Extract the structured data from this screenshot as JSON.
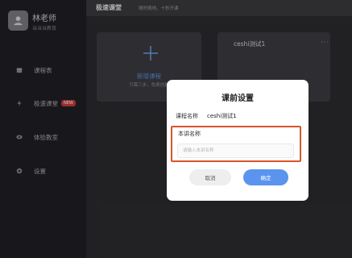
{
  "sidebar": {
    "teacher_name": "林老师",
    "org": "当当当教育",
    "items": [
      {
        "label": "课程表",
        "icon": "calendar-icon"
      },
      {
        "label": "极速课堂",
        "icon": "lightning-icon",
        "badge": "NEW"
      },
      {
        "label": "体验教室",
        "icon": "eye-icon"
      },
      {
        "label": "设置",
        "icon": "gear-icon"
      }
    ]
  },
  "header": {
    "title": "极速课堂",
    "subtitle": "随时随地，十秒开课"
  },
  "cards": {
    "new_title": "新增课程",
    "new_sub": "只需三步，免费创建",
    "course_name": "ceshi测试1",
    "menu_dots": "···"
  },
  "modal": {
    "title": "课前设置",
    "course_label": "课程名称",
    "course_value": "ceshi测试1",
    "speaker_label": "本讲名称",
    "speaker_placeholder": "请输入本讲名称",
    "cancel": "取消",
    "confirm": "确定"
  },
  "colors": {
    "accent": "#5a94ee",
    "highlight_border": "#d9542c",
    "badge": "#c73a3a"
  }
}
